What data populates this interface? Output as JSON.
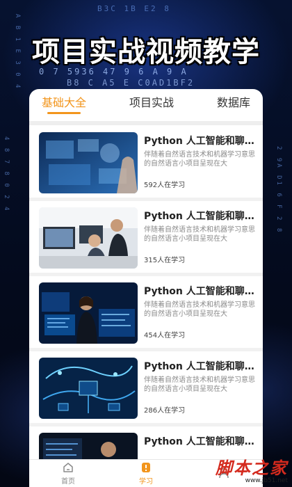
{
  "headline": "项目实战视频教学",
  "background_code": [
    "B3C  1B  E2 8",
    "0  7  5936 47  9  6  A    9  A",
    "B8 C  A5 E  C0AD1BF2",
    "4   8    7  8  0  2  4",
    "2  9A  D1  6  F  2  8",
    "A  B  1  E  3  0  4"
  ],
  "tabs": [
    {
      "label": "基础大全",
      "active": true
    },
    {
      "label": "项目实战",
      "active": false
    },
    {
      "label": "数据库",
      "active": false
    }
  ],
  "courses": [
    {
      "title": "Python 人工智能和聊...",
      "description": "伴随着自然语言技术和机器学习意思的自然语言小项目呈现在大",
      "learners": "592人在学习",
      "thumbnail_icon": "ai-touchscreen-thumbnail"
    },
    {
      "title": "Python 人工智能和聊...",
      "description": "伴随着自然语言技术和机器学习意思的自然语言小项目呈现在大",
      "learners": "315人在学习",
      "thumbnail_icon": "office-team-thumbnail"
    },
    {
      "title": "Python 人工智能和聊...",
      "description": "伴随着自然语言技术和机器学习意思的自然语言小项目呈现在大",
      "learners": "454人在学习",
      "thumbnail_icon": "developer-monitors-thumbnail"
    },
    {
      "title": "Python 人工智能和聊...",
      "description": "伴随着自然语言技术和机器学习意思的自然语言小项目呈现在大",
      "learners": "286人在学习",
      "thumbnail_icon": "circuit-board-thumbnail"
    },
    {
      "title": "Python 人工智能和聊...",
      "description": "",
      "learners": "",
      "thumbnail_icon": "server-room-thumbnail"
    }
  ],
  "bottom_nav": [
    {
      "label": "首页",
      "icon": "home-icon",
      "active": false
    },
    {
      "label": "学习",
      "icon": "study-icon",
      "active": true
    },
    {
      "label": "",
      "icon": "profile-icon",
      "active": false
    }
  ],
  "watermark": {
    "main": "脚本之家",
    "url": "www.jb51.net"
  },
  "colors": {
    "accent": "#f2951c",
    "background": "#050b1e",
    "watermark": "#d42a1e"
  }
}
